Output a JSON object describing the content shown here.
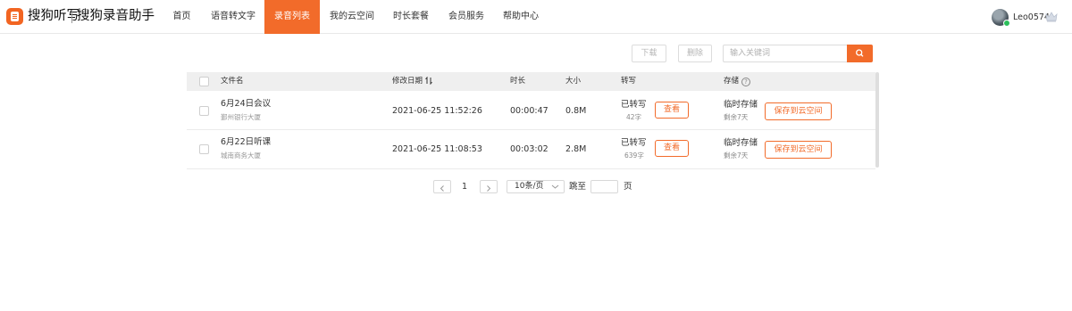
{
  "app": {
    "brand": "搜狗听写",
    "product": "搜狗录音助手"
  },
  "nav": {
    "items": [
      {
        "label": "首页"
      },
      {
        "label": "语音转文字"
      },
      {
        "label": "录音列表"
      },
      {
        "label": "我的云空间"
      },
      {
        "label": "时长套餐"
      },
      {
        "label": "会员服务"
      },
      {
        "label": "帮助中心"
      }
    ],
    "active_index": 2
  },
  "user": {
    "name": "Leo0574"
  },
  "toolbar": {
    "download_label": "下载",
    "delete_label": "删除",
    "search_placeholder": "输入关键词"
  },
  "table": {
    "columns": {
      "filename": "文件名",
      "modified": "修改日期",
      "duration": "时长",
      "size": "大小",
      "transcribe": "转写",
      "storage": "存储"
    },
    "rows": [
      {
        "name": "6月24日会议",
        "location": "鄞州银行大厦",
        "date": "2021-06-25 11:52:26",
        "duration": "00:00:47",
        "size": "0.8M",
        "status": "已转写",
        "words": "42字",
        "view_label": "查看",
        "storage": "临时存储",
        "remain": "剩余7天",
        "save_label": "保存到云空间"
      },
      {
        "name": "6月22日听课",
        "location": "城南商务大厦",
        "date": "2021-06-25 11:08:53",
        "duration": "00:03:02",
        "size": "2.8M",
        "status": "已转写",
        "words": "639字",
        "view_label": "查看",
        "storage": "临时存储",
        "remain": "剩余7天",
        "save_label": "保存到云空间"
      }
    ]
  },
  "pagination": {
    "current": "1",
    "page_size": "10条/页",
    "jump_label": "跳至",
    "page_unit": "页"
  },
  "colors": {
    "accent": "#f26b2a",
    "header_bg": "#efefef",
    "online": "#2bbf5b"
  }
}
